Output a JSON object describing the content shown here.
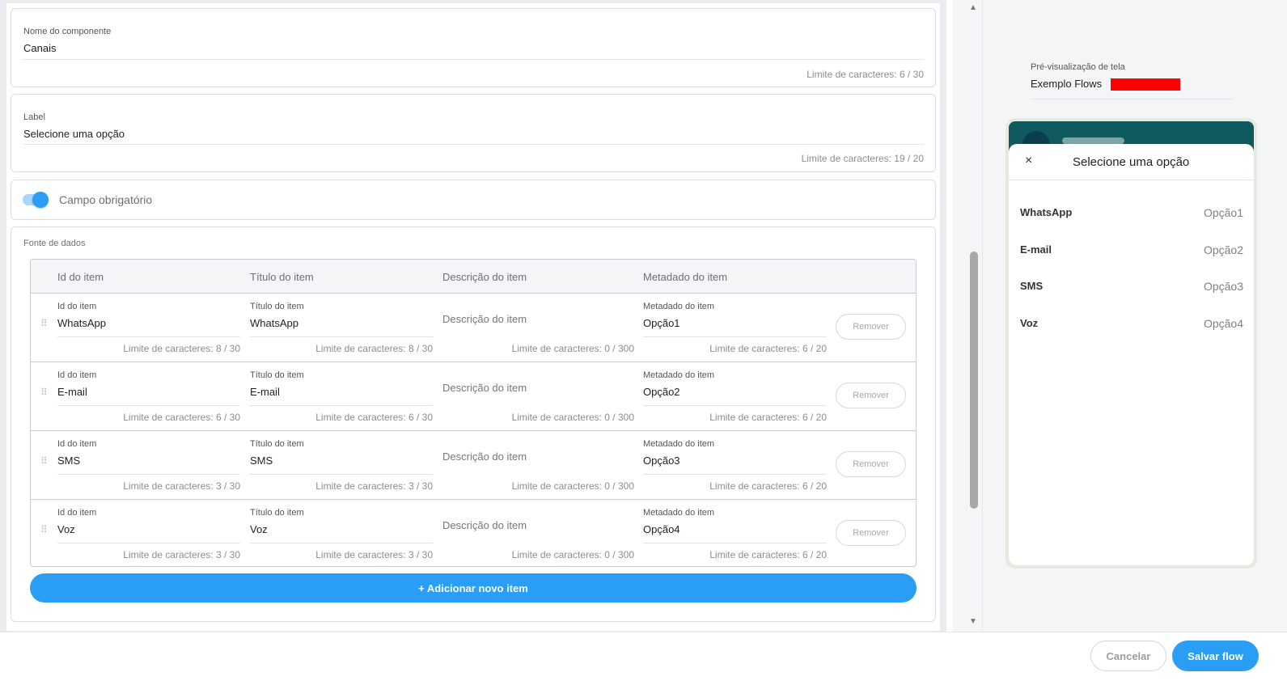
{
  "component_name": {
    "label": "Nome do componente",
    "value": "Canais",
    "limit": "Limite de caracteres: 6 / 30"
  },
  "label_field": {
    "label": "Label",
    "value": "Selecione uma opção",
    "limit": "Limite de caracteres: 19 / 20"
  },
  "required_toggle": {
    "label": "Campo obrigatório",
    "checked": true
  },
  "data_source": {
    "title": "Fonte de dados",
    "headers": [
      "Id do item",
      "Título do item",
      "Descrição do item",
      "Metadado do item"
    ],
    "rows": [
      {
        "id_label": "Id do item",
        "id": "WhatsApp",
        "id_limit": "Limite de caracteres: 8 / 30",
        "title_label": "Título do item",
        "title": "WhatsApp",
        "title_limit": "Limite de caracteres: 8 / 30",
        "desc": "Descrição do item",
        "desc_limit": "Limite de caracteres: 0 / 300",
        "meta_label": "Metadado do item",
        "meta": "Opção1",
        "meta_limit": "Limite de caracteres: 6 / 20",
        "remove": "Remover"
      },
      {
        "id_label": "Id do item",
        "id": "E-mail",
        "id_limit": "Limite de caracteres: 6 / 30",
        "title_label": "Título do item",
        "title": "E-mail",
        "title_limit": "Limite de caracteres: 6 / 30",
        "desc": "Descrição do item",
        "desc_limit": "Limite de caracteres: 0 / 300",
        "meta_label": "Metadado do item",
        "meta": "Opção2",
        "meta_limit": "Limite de caracteres: 6 / 20",
        "remove": "Remover"
      },
      {
        "id_label": "Id do item",
        "id": "SMS",
        "id_limit": "Limite de caracteres: 3 / 30",
        "title_label": "Título do item",
        "title": "SMS",
        "title_limit": "Limite de caracteres: 3 / 30",
        "desc": "Descrição do item",
        "desc_limit": "Limite de caracteres: 0 / 300",
        "meta_label": "Metadado do item",
        "meta": "Opção3",
        "meta_limit": "Limite de caracteres: 6 / 20",
        "remove": "Remover"
      },
      {
        "id_label": "Id do item",
        "id": "Voz",
        "id_limit": "Limite de caracteres: 3 / 30",
        "title_label": "Título do item",
        "title": "Voz",
        "title_limit": "Limite de caracteres: 3 / 30",
        "desc": "Descrição do item",
        "desc_limit": "Limite de caracteres: 0 / 300",
        "meta_label": "Metadado do item",
        "meta": "Opção4",
        "meta_limit": "Limite de caracteres: 6 / 20",
        "remove": "Remover"
      }
    ],
    "add_button": "+ Adicionar novo item"
  },
  "preview": {
    "label": "Pré-visualização de tela",
    "name": "Exemplo Flows",
    "sheet_title": "Selecione uma opção",
    "close_icon": "×",
    "options": [
      {
        "title": "WhatsApp",
        "meta": "Opção1"
      },
      {
        "title": "E-mail",
        "meta": "Opção2"
      },
      {
        "title": "SMS",
        "meta": "Opção3"
      },
      {
        "title": "Voz",
        "meta": "Opção4"
      }
    ]
  },
  "footer": {
    "cancel": "Cancelar",
    "save": "Salvar flow"
  },
  "colors": {
    "accent": "#2a9df4",
    "redaction": "#ff0000",
    "phone_header": "#0e5a5e"
  }
}
